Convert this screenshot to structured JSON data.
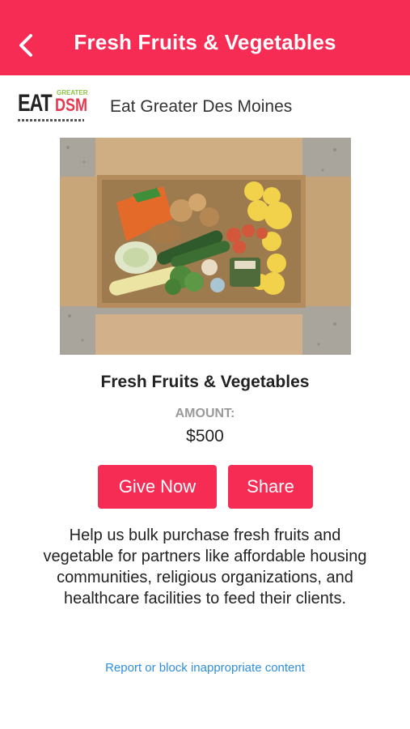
{
  "header": {
    "title": "Fresh Fruits & Vegetables",
    "back_icon": "chevron-left-icon",
    "background_color": "#f72c55"
  },
  "organization": {
    "name": "Eat Greater Des Moines",
    "logo": {
      "eat": "EAT",
      "greater": "GREATER",
      "dsm": "DSM"
    }
  },
  "product": {
    "title": "Fresh Fruits & Vegetables",
    "amount_label": "AMOUNT:",
    "amount": "$500",
    "description": "Help us bulk purchase fresh fruits and vegetable for partners like affordable housing communities, religious organizations, and healthcare facilities to feed their clients."
  },
  "actions": {
    "give_now": "Give Now",
    "share": "Share"
  },
  "footer": {
    "report_link": "Report or block inappropriate content",
    "link_color": "#2f8fe0"
  }
}
